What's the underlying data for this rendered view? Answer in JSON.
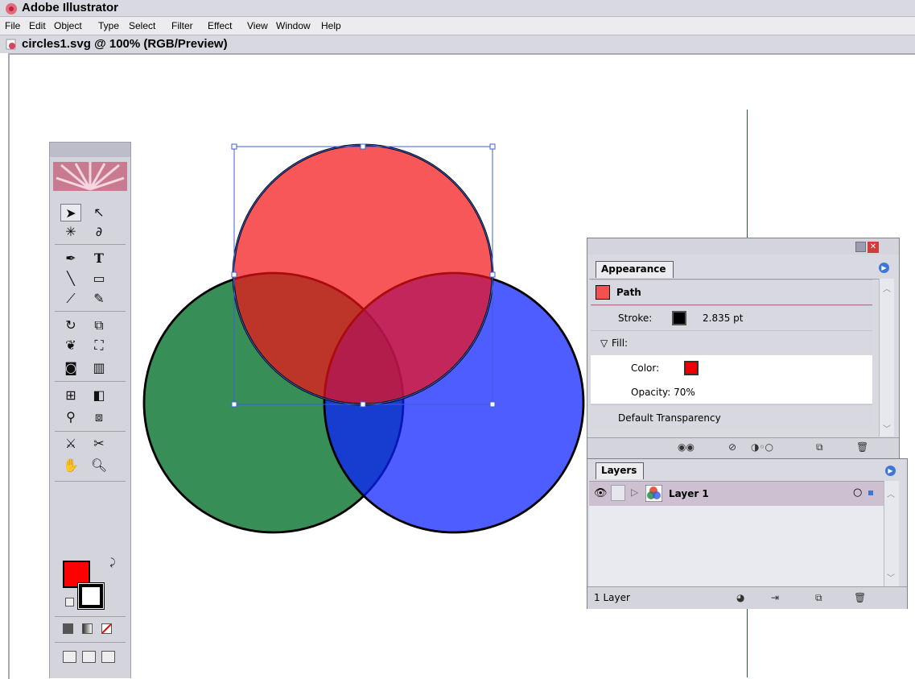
{
  "app": {
    "title": "Adobe Illustrator"
  },
  "menu": [
    "File",
    "Edit",
    "Object",
    "Type",
    "Select",
    "Filter",
    "Effect",
    "View",
    "Window",
    "Help"
  ],
  "document": {
    "title": "circles1.svg @ 100% (RGB/Preview)"
  },
  "artwork": {
    "circles": [
      {
        "name": "red-circle",
        "color": "#f50f14",
        "opacity": 0.7
      },
      {
        "name": "green-circle",
        "color": "#006e28",
        "opacity": 0.78
      },
      {
        "name": "blue-circle",
        "color": "#0a1eff",
        "opacity": 0.72
      }
    ]
  },
  "toolbox": {
    "icons": [
      "selection-tool-icon",
      "direct-selection-tool-icon",
      "magic-wand-tool-icon",
      "lasso-tool-icon",
      "pen-tool-icon",
      "type-tool-icon",
      "line-segment-tool-icon",
      "rectangle-tool-icon",
      "paintbrush-tool-icon",
      "pencil-tool-icon",
      "rotate-tool-icon",
      "scale-tool-icon",
      "warp-tool-icon",
      "free-transform-tool-icon",
      "symbol-sprayer-tool-icon",
      "column-graph-tool-icon",
      "mesh-tool-icon",
      "gradient-tool-icon",
      "eyedropper-tool-icon",
      "blend-tool-icon",
      "slice-tool-icon",
      "scissors-tool-icon",
      "hand-tool-icon",
      "zoom-tool-icon"
    ],
    "fill_color": "#ff0000",
    "stroke_color": "#000000"
  },
  "appearance_panel": {
    "tab": "Appearance",
    "path_label": "Path",
    "stroke_label": "Stroke:",
    "stroke_value": "2.835 pt",
    "fill_label": "Fill:",
    "color_label": "Color:",
    "opacity_label": "Opacity: 70%",
    "default_transparency": "Default Transparency"
  },
  "layers_panel": {
    "tab": "Layers",
    "layer_name": "Layer 1",
    "footer_count": "1 Layer"
  }
}
